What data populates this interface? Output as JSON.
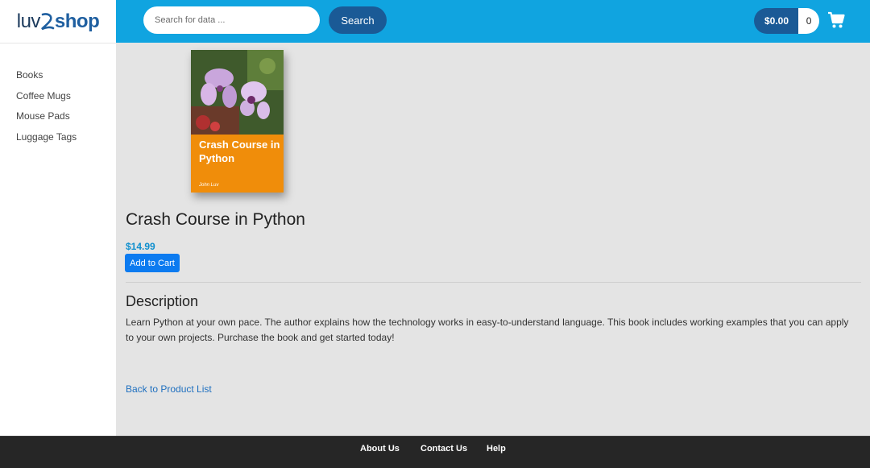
{
  "brand": {
    "logo_text_left": "luv",
    "logo_text_right": "shop"
  },
  "header": {
    "search_placeholder": "Search for data ...",
    "search_label": "Search",
    "cart_total": "$0.00",
    "cart_quantity": "0",
    "cart_icon": "shopping-cart-icon"
  },
  "sidebar": {
    "items": [
      {
        "label": "Books"
      },
      {
        "label": "Coffee Mugs"
      },
      {
        "label": "Mouse Pads"
      },
      {
        "label": "Luggage Tags"
      }
    ]
  },
  "product": {
    "cover_title": "Crash Course in Python",
    "cover_author": "John Luv",
    "name": "Crash Course in Python",
    "price": "$14.99",
    "add_to_cart_label": "Add to Cart",
    "description_heading": "Description",
    "description": "Learn Python at your own pace. The author explains how the technology works in easy-to-understand language. This book includes working examples that you can apply to your own projects. Purchase the book and get started today!",
    "back_link": "Back to Product List",
    "cover_color": "#f08d0a"
  },
  "footer": {
    "links": [
      {
        "label": "About Us"
      },
      {
        "label": "Contact Us"
      },
      {
        "label": "Help"
      }
    ]
  },
  "colors": {
    "topbar": "#10a4e0",
    "accent_dark": "#1a5a96",
    "price": "#0f8fce",
    "button": "#0c7bf0",
    "footer": "#262626"
  }
}
